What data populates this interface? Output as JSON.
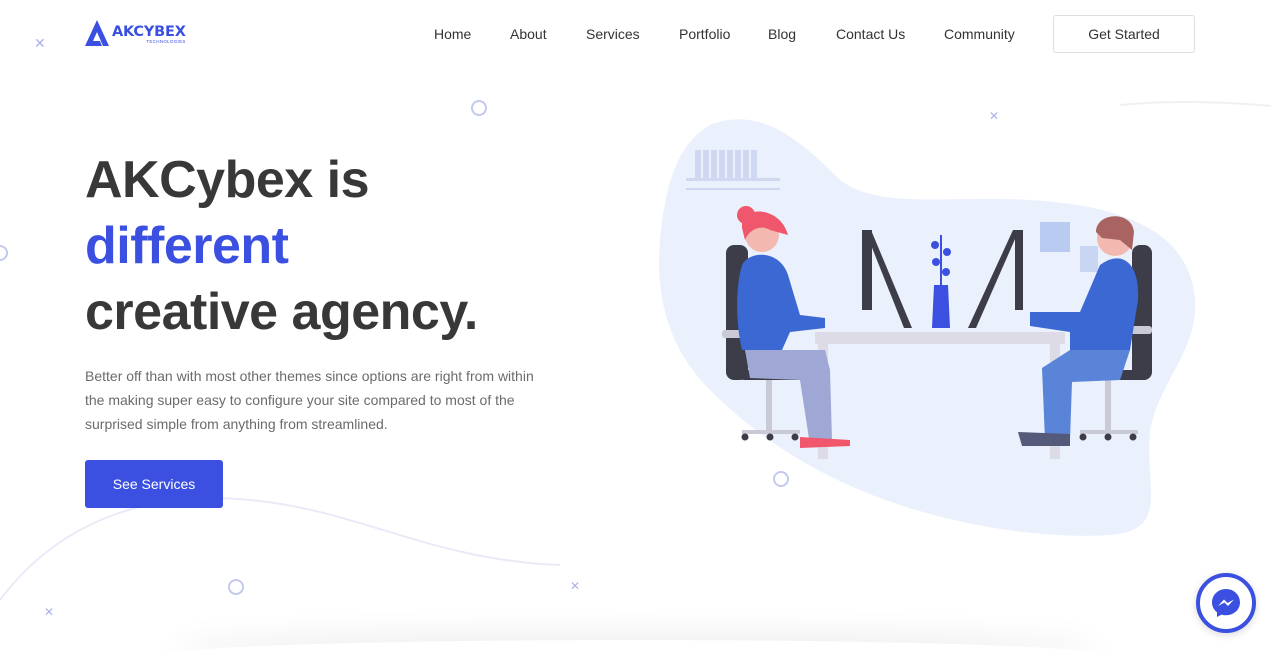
{
  "brand": {
    "name": "AKCYBEX",
    "tagline": "TECHNOLOGIES",
    "accent_color": "#3b50e0"
  },
  "nav": {
    "items": [
      {
        "label": "Home"
      },
      {
        "label": "About"
      },
      {
        "label": "Services"
      },
      {
        "label": "Portfolio"
      },
      {
        "label": "Blog"
      },
      {
        "label": "Contact Us"
      },
      {
        "label": "Community"
      }
    ],
    "cta_label": "Get Started"
  },
  "hero": {
    "title_line1": "AKCybex is",
    "title_line2": "different",
    "title_line3": "creative agency.",
    "description": "Better off than with most other themes since options are right from within the making super easy to configure your site compared to most of the surprised simple from anything from streamlined.",
    "button_label": "See Services"
  },
  "icons": {
    "chat": "messenger-icon",
    "logo": "logo-mark-icon"
  }
}
